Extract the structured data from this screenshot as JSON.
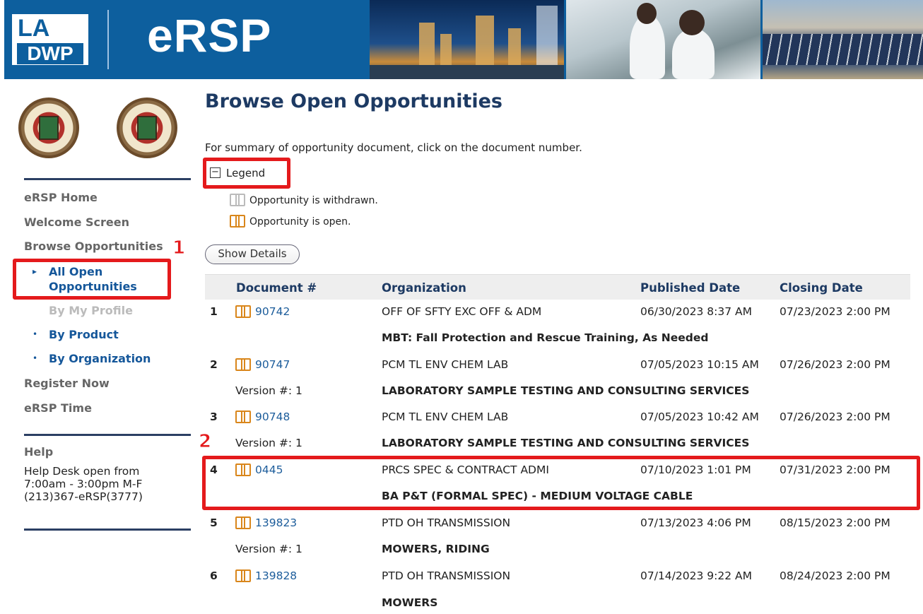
{
  "header": {
    "logo_line1": "LA",
    "logo_line2": "DWP",
    "app_title": "eRSP"
  },
  "sidebar": {
    "nav": [
      {
        "label": "eRSP Home"
      },
      {
        "label": "Welcome Screen"
      },
      {
        "label": "Browse Opportunities"
      },
      {
        "label": "All Open Opportunities"
      },
      {
        "label": "By My Profile"
      },
      {
        "label": "By Product"
      },
      {
        "label": "By Organization"
      },
      {
        "label": "Register Now"
      },
      {
        "label": "eRSP Time"
      }
    ],
    "help_title": "Help",
    "help_text": "Help Desk open from\n7:00am - 3:00pm M-F\n(213)367-eRSP(3777)"
  },
  "annotations": [
    "1",
    "2"
  ],
  "main": {
    "title": "Browse Open Opportunities",
    "intro": "For summary of opportunity document, click on the document number.",
    "legend_toggle": "−",
    "legend_label": "Legend",
    "legend_withdrawn": "Opportunity is withdrawn.",
    "legend_open": "Opportunity is open.",
    "show_details": "Show Details",
    "columns": [
      "Document #",
      "Organization",
      "Published Date",
      "Closing Date"
    ],
    "rows": [
      {
        "num": "1",
        "doc": "90742",
        "org": "OFF OF SFTY EXC OFF & ADM",
        "published": "06/30/2023 8:37 AM",
        "closing": "07/23/2023 2:00 PM",
        "version": "",
        "desc": "MBT: Fall Protection and Rescue Training, As Needed"
      },
      {
        "num": "2",
        "doc": "90747",
        "org": "PCM TL ENV CHEM LAB",
        "published": "07/05/2023 10:15 AM",
        "closing": "07/26/2023 2:00 PM",
        "version": "Version #: 1",
        "desc": "LABORATORY SAMPLE TESTING AND CONSULTING SERVICES"
      },
      {
        "num": "3",
        "doc": "90748",
        "org": "PCM TL ENV CHEM LAB",
        "published": "07/05/2023 10:42 AM",
        "closing": "07/26/2023 2:00 PM",
        "version": "Version #: 1",
        "desc": "LABORATORY SAMPLE TESTING AND CONSULTING SERVICES"
      },
      {
        "num": "4",
        "doc": "0445",
        "org": "PRCS SPEC & CONTRACT ADMI",
        "published": "07/10/2023 1:01 PM",
        "closing": "07/31/2023 2:00 PM",
        "version": "",
        "desc": "BA P&T (FORMAL SPEC) - MEDIUM VOLTAGE CABLE"
      },
      {
        "num": "5",
        "doc": "139823",
        "org": "PTD OH TRANSMISSION",
        "published": "07/13/2023 4:06 PM",
        "closing": "08/15/2023 2:00 PM",
        "version": "Version #: 1",
        "desc": "MOWERS, RIDING"
      },
      {
        "num": "6",
        "doc": "139828",
        "org": "PTD OH TRANSMISSION",
        "published": "07/14/2023 9:22 AM",
        "closing": "08/24/2023 2:00 PM",
        "version": "",
        "desc": "MOWERS"
      }
    ]
  },
  "colors": {
    "banner": "#0d5f9e",
    "title": "#1d3a63",
    "link": "#1d5d9b",
    "open_icon": "#d9861b",
    "annotation": "#e41a1c"
  }
}
